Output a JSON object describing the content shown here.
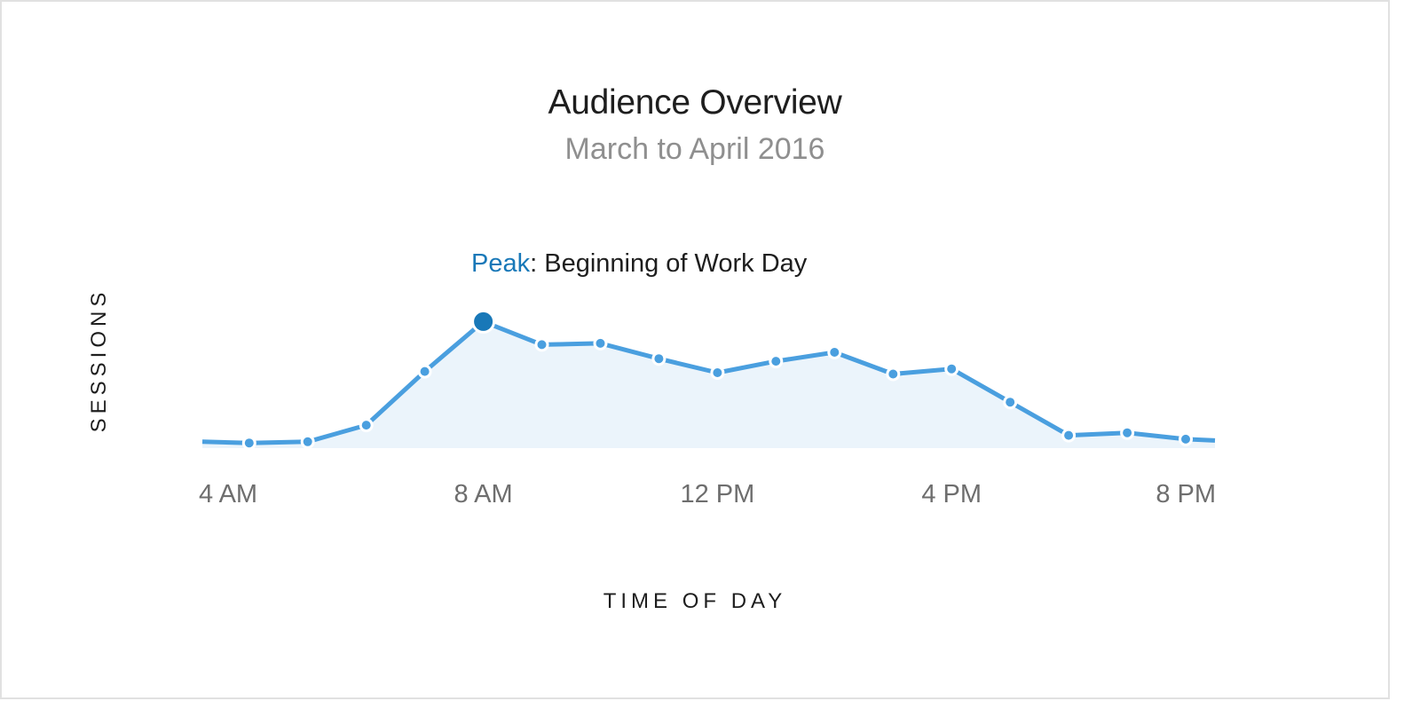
{
  "chart_data": {
    "type": "area",
    "title": "Audience Overview",
    "subtitle": "March to April 2016",
    "xlabel": "TIME OF DAY",
    "ylabel": "SESSIONS",
    "x_tick_labels": [
      "4 AM",
      "8 AM",
      "12 PM",
      "4 PM",
      "8 PM"
    ],
    "x_tick_values": [
      4,
      8,
      12,
      16,
      20
    ],
    "xlim": [
      3.2,
      20.5
    ],
    "ylim": [
      0,
      100
    ],
    "x": [
      3.2,
      4,
      5,
      6,
      7,
      8,
      9,
      10,
      11,
      12,
      13,
      14,
      15,
      16,
      17,
      18,
      19,
      20,
      20.5
    ],
    "values": [
      5,
      4,
      5,
      18,
      60,
      99,
      81,
      82,
      70,
      59,
      68,
      75,
      58,
      62,
      36,
      10,
      12,
      7,
      6
    ],
    "marker_points": [
      4,
      5,
      6,
      7,
      8,
      9,
      10,
      11,
      12,
      13,
      14,
      15,
      16,
      17,
      18,
      19,
      20
    ],
    "highlight": {
      "x": 8,
      "label_key": "Peak",
      "label_text": ": Beginning of Work Day"
    },
    "grid": false,
    "legend": "none",
    "colors": {
      "line": "#4a9fdf",
      "fill": "#ebf4fb",
      "highlight": "#1878b8",
      "marker_stroke": "#ffffff"
    }
  }
}
